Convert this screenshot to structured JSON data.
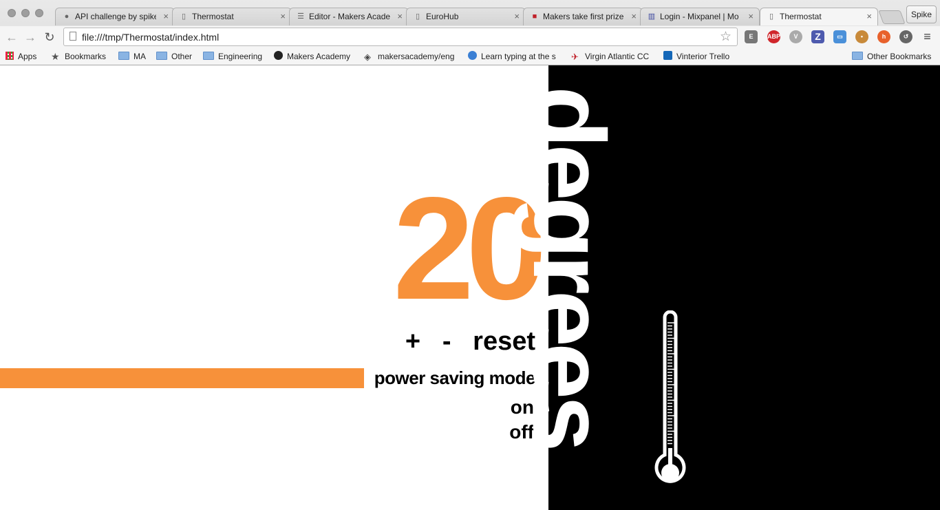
{
  "browser": {
    "tabs": [
      {
        "title": "API challenge by spike",
        "icon": "github-icon"
      },
      {
        "title": "Thermostat",
        "icon": "page-icon"
      },
      {
        "title": "Editor - Makers Acade",
        "icon": "editor-icon"
      },
      {
        "title": "EuroHub",
        "icon": "page-icon"
      },
      {
        "title": "Makers take first prize",
        "icon": "makers-icon"
      },
      {
        "title": "Login - Mixpanel | Mo",
        "icon": "mixpanel-icon"
      },
      {
        "title": "Thermostat",
        "icon": "page-icon"
      }
    ],
    "active_tab": 6,
    "profile": "Spike",
    "url": "file:///tmp/Thermostat/index.html",
    "bookmarks": [
      {
        "label": "Apps",
        "icon": "apps-grid-icon"
      },
      {
        "label": "Bookmarks",
        "icon": "star-icon"
      },
      {
        "label": "MA",
        "icon": "folder-icon"
      },
      {
        "label": "Other",
        "icon": "folder-icon"
      },
      {
        "label": "Engineering",
        "icon": "folder-icon"
      },
      {
        "label": "Makers Academy",
        "icon": "github-icon"
      },
      {
        "label": "makersacademy/eng",
        "icon": "diamond-icon"
      },
      {
        "label": "Learn typing at the s",
        "icon": "cursor-icon"
      },
      {
        "label": "Virgin Atlantic CC",
        "icon": "plane-icon"
      },
      {
        "label": "Vinterior Trello",
        "icon": "trello-icon"
      }
    ],
    "other_bookmarks": "Other Bookmarks",
    "extensions": [
      "ABP",
      "Z"
    ]
  },
  "thermostat": {
    "temperature": "20",
    "unit_word": "degrees",
    "controls": {
      "up": "+",
      "down": "-",
      "reset": "reset"
    },
    "power_saving": {
      "label": "power saving mode",
      "on": "on",
      "off": "off"
    },
    "colors": {
      "accent": "#f7913a",
      "panel": "#000000",
      "text": "#000000"
    }
  }
}
